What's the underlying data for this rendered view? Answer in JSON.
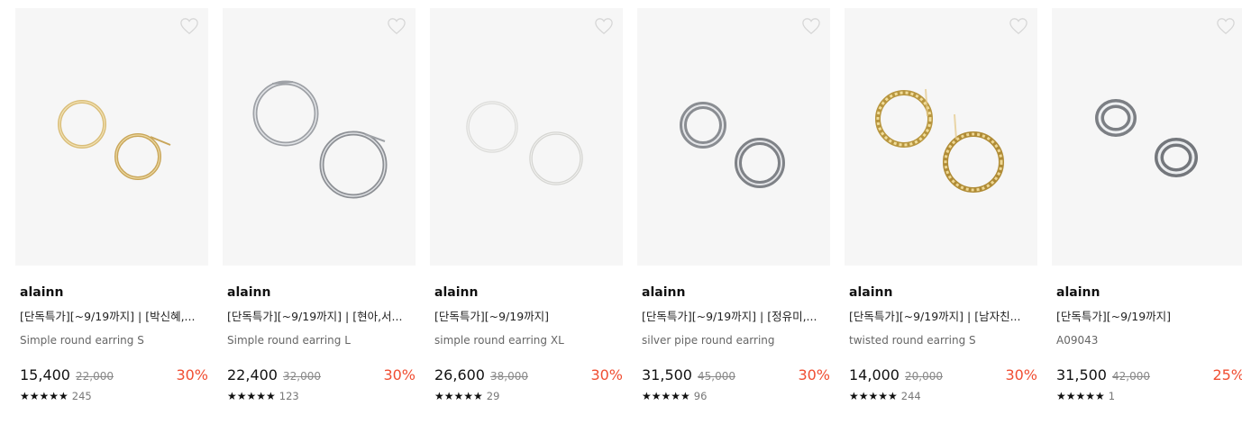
{
  "products": [
    {
      "brand": "alainn",
      "title": "[단독특가][~9/19까지] | [박신혜,...",
      "subtitle": "Simple round earring S",
      "price": "15,400",
      "original_price": "22,000",
      "discount": "30%",
      "stars": "★★★★★",
      "review_count": "245",
      "metal": "gold",
      "style": "thin-hoop"
    },
    {
      "brand": "alainn",
      "title": "[단독특가][~9/19까지] | [현아,서...",
      "subtitle": "Simple round earring L",
      "price": "22,400",
      "original_price": "32,000",
      "discount": "30%",
      "stars": "★★★★★",
      "review_count": "123",
      "metal": "silver",
      "style": "large-hoop"
    },
    {
      "brand": "alainn",
      "title": "[단독특가][~9/19까지]",
      "subtitle": "simple round earring XL",
      "price": "26,600",
      "original_price": "38,000",
      "discount": "30%",
      "stars": "★★★★★",
      "review_count": "29",
      "metal": "pale-silver",
      "style": "thin-hoop"
    },
    {
      "brand": "alainn",
      "title": "[단독특가][~9/19까지] | [정유미,...",
      "subtitle": "silver pipe round earring",
      "price": "31,500",
      "original_price": "45,000",
      "discount": "30%",
      "stars": "★★★★★",
      "review_count": "96",
      "metal": "silver",
      "style": "pipe-hoop"
    },
    {
      "brand": "alainn",
      "title": "[단독특가][~9/19까지] | [남자친...",
      "subtitle": "twisted round earring S",
      "price": "14,000",
      "original_price": "20,000",
      "discount": "30%",
      "stars": "★★★★★",
      "review_count": "244",
      "metal": "gold",
      "style": "twisted-hoop"
    },
    {
      "brand": "alainn",
      "title": "[단독특가][~9/19까지]",
      "subtitle": "A09043",
      "price": "31,500",
      "original_price": "42,000",
      "discount": "25%",
      "stars": "★★★★★",
      "review_count": "1",
      "metal": "silver",
      "style": "chunky-hoop"
    }
  ],
  "icons": {
    "wishlist": "heart-outline-icon",
    "rating": "star-icon"
  },
  "colors": {
    "discount": "#f04e32",
    "gold": "#c9a65a",
    "silver": "#a9acb1",
    "thumb_bg": "#f6f6f6"
  }
}
